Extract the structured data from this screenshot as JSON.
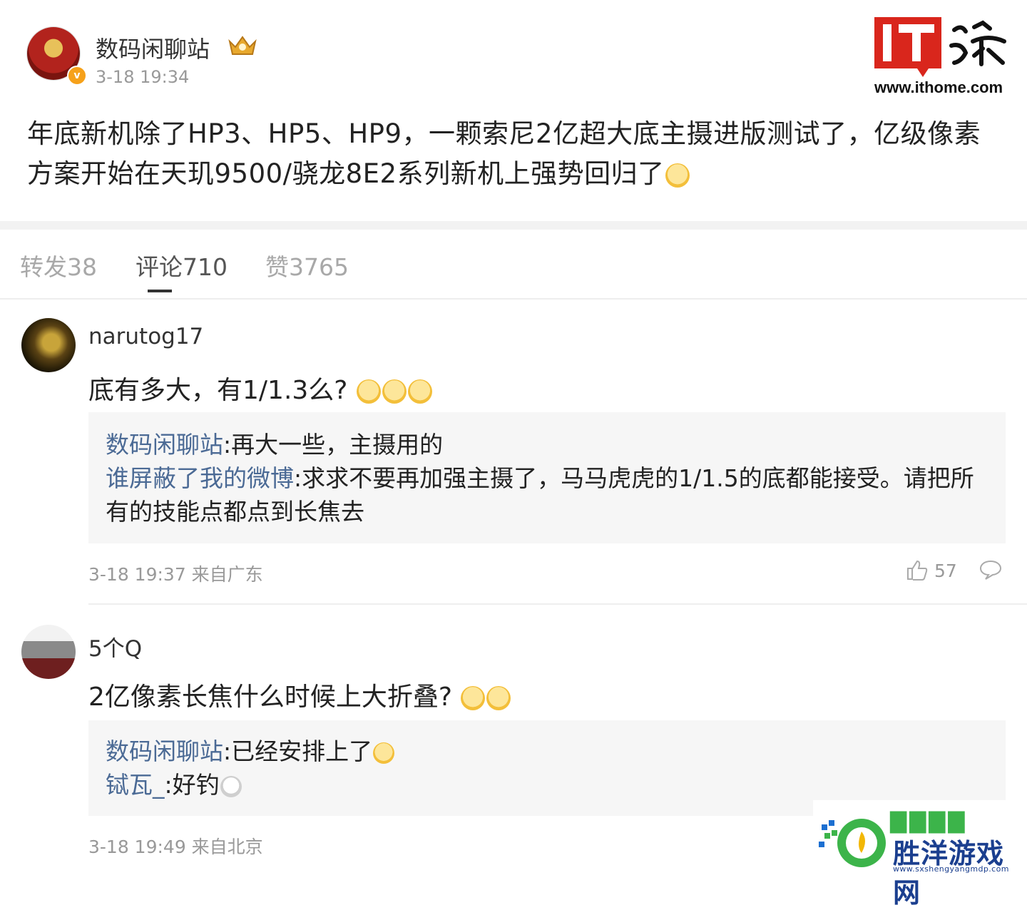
{
  "post": {
    "author": "数码闲聊站",
    "time": "3-18 19:34",
    "verify_badge": "v",
    "body_line1": "年底新机除了HP3、HP5、HP9，一颗索尼2亿超大底主摄进版测试了，亿级像素",
    "body_line2": "方案开始在天玑9500/骁龙8E2系列新机上强势回归了"
  },
  "brand": {
    "logo_text": "IT之家",
    "url": "www.ithome.com"
  },
  "tabs": [
    {
      "label": "转发38"
    },
    {
      "label": "评论710"
    },
    {
      "label": "赞3765"
    }
  ],
  "comments": [
    {
      "user": "narutog17",
      "text": "底有多大，有1/1.3么?",
      "replies": [
        {
          "user": "数码闲聊站",
          "text": ":再大一些，主摄用的"
        },
        {
          "user": "谁屏蔽了我的微博",
          "text": ":求求不要再加强主摄了，马马虎虎的1/1.5的底都能接受。请把所",
          "text_cont": "有的技能点都点到长焦去"
        }
      ],
      "meta": "3-18 19:37 来自广东",
      "likes": "57"
    },
    {
      "user": "5个Q",
      "text": "2亿像素长焦什么时候上大折叠?",
      "replies": [
        {
          "user": "数码闲聊站",
          "text": ":已经安排上了"
        },
        {
          "user": "铽瓦_",
          "text": ":好钓"
        }
      ],
      "meta": "3-18 19:49 来自北京"
    }
  ],
  "watermark": {
    "title": "胜洋游戏网",
    "url": "www.sxshengyangmdp.com"
  },
  "colors": {
    "reply_user": "#4b6a95",
    "brand_red": "#d9261c",
    "watermark_blue": "#1b3f8f"
  }
}
